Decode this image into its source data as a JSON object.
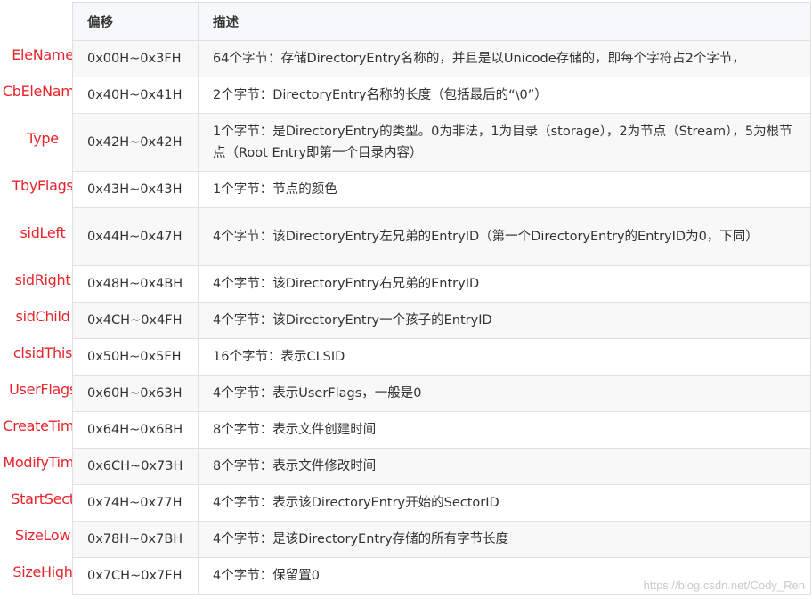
{
  "table": {
    "headers": [
      "偏移",
      "描述"
    ],
    "rows": [
      {
        "name": "EleName",
        "offset": "0x00H~0x3FH",
        "desc": "64个字节：存储DirectoryEntry名称的，并且是以Unicode存储的，即每个字符占2个字节，"
      },
      {
        "name": "CbEleName",
        "offset": "0x40H~0x41H",
        "desc": "2个字节：DirectoryEntry名称的长度（包括最后的“\\0”）"
      },
      {
        "name": "Type",
        "offset": "0x42H~0x42H",
        "desc": "1个字节：是DirectoryEntry的类型。0为非法，1为目录（storage），2为节点（Stream），5为根节点（Root Entry即第一个目录内容）"
      },
      {
        "name": "TbyFlags",
        "offset": "0x43H~0x43H",
        "desc": "1个字节：节点的颜色"
      },
      {
        "name": "sidLeft",
        "offset": "0x44H~0x47H",
        "desc": "4个字节：该DirectoryEntry左兄弟的EntryID（第一个DirectoryEntry的EntryID为0，下同）"
      },
      {
        "name": "sidRight",
        "offset": "0x48H~0x4BH",
        "desc": "4个字节：该DirectoryEntry右兄弟的EntryID"
      },
      {
        "name": "sidChild",
        "offset": "0x4CH~0x4FH",
        "desc": "4个字节：该DirectoryEntry一个孩子的EntryID"
      },
      {
        "name": "clsidThis",
        "offset": "0x50H~0x5FH",
        "desc": "16个字节：表示CLSID"
      },
      {
        "name": "UserFlags",
        "offset": "0x60H~0x63H",
        "desc": "4个字节：表示UserFlags，一般是0"
      },
      {
        "name": "CreateTime",
        "offset": "0x64H~0x6BH",
        "desc": "8个字节：表示文件创建时间"
      },
      {
        "name": "ModifyTime",
        "offset": "0x6CH~0x73H",
        "desc": "8个字节：表示文件修改时间"
      },
      {
        "name": "StartSect",
        "offset": "0x74H~0x77H",
        "desc": "4个字节：表示该DirectoryEntry开始的SectorID"
      },
      {
        "name": "SizeLow",
        "offset": "0x78H~0x7BH",
        "desc": "4个字节：是该DirectoryEntry存储的所有字节长度"
      },
      {
        "name": "SizeHigh",
        "offset": "0x7CH~0x7FH",
        "desc": "4个字节：保留置0"
      }
    ]
  },
  "watermark": "https://blog.csdn.net/Cody_Ren",
  "colors": {
    "label": "#e8242b",
    "header_bg": "#f6f8fa",
    "stripe": "#f8f8f8",
    "border": "#dfe2e5"
  }
}
